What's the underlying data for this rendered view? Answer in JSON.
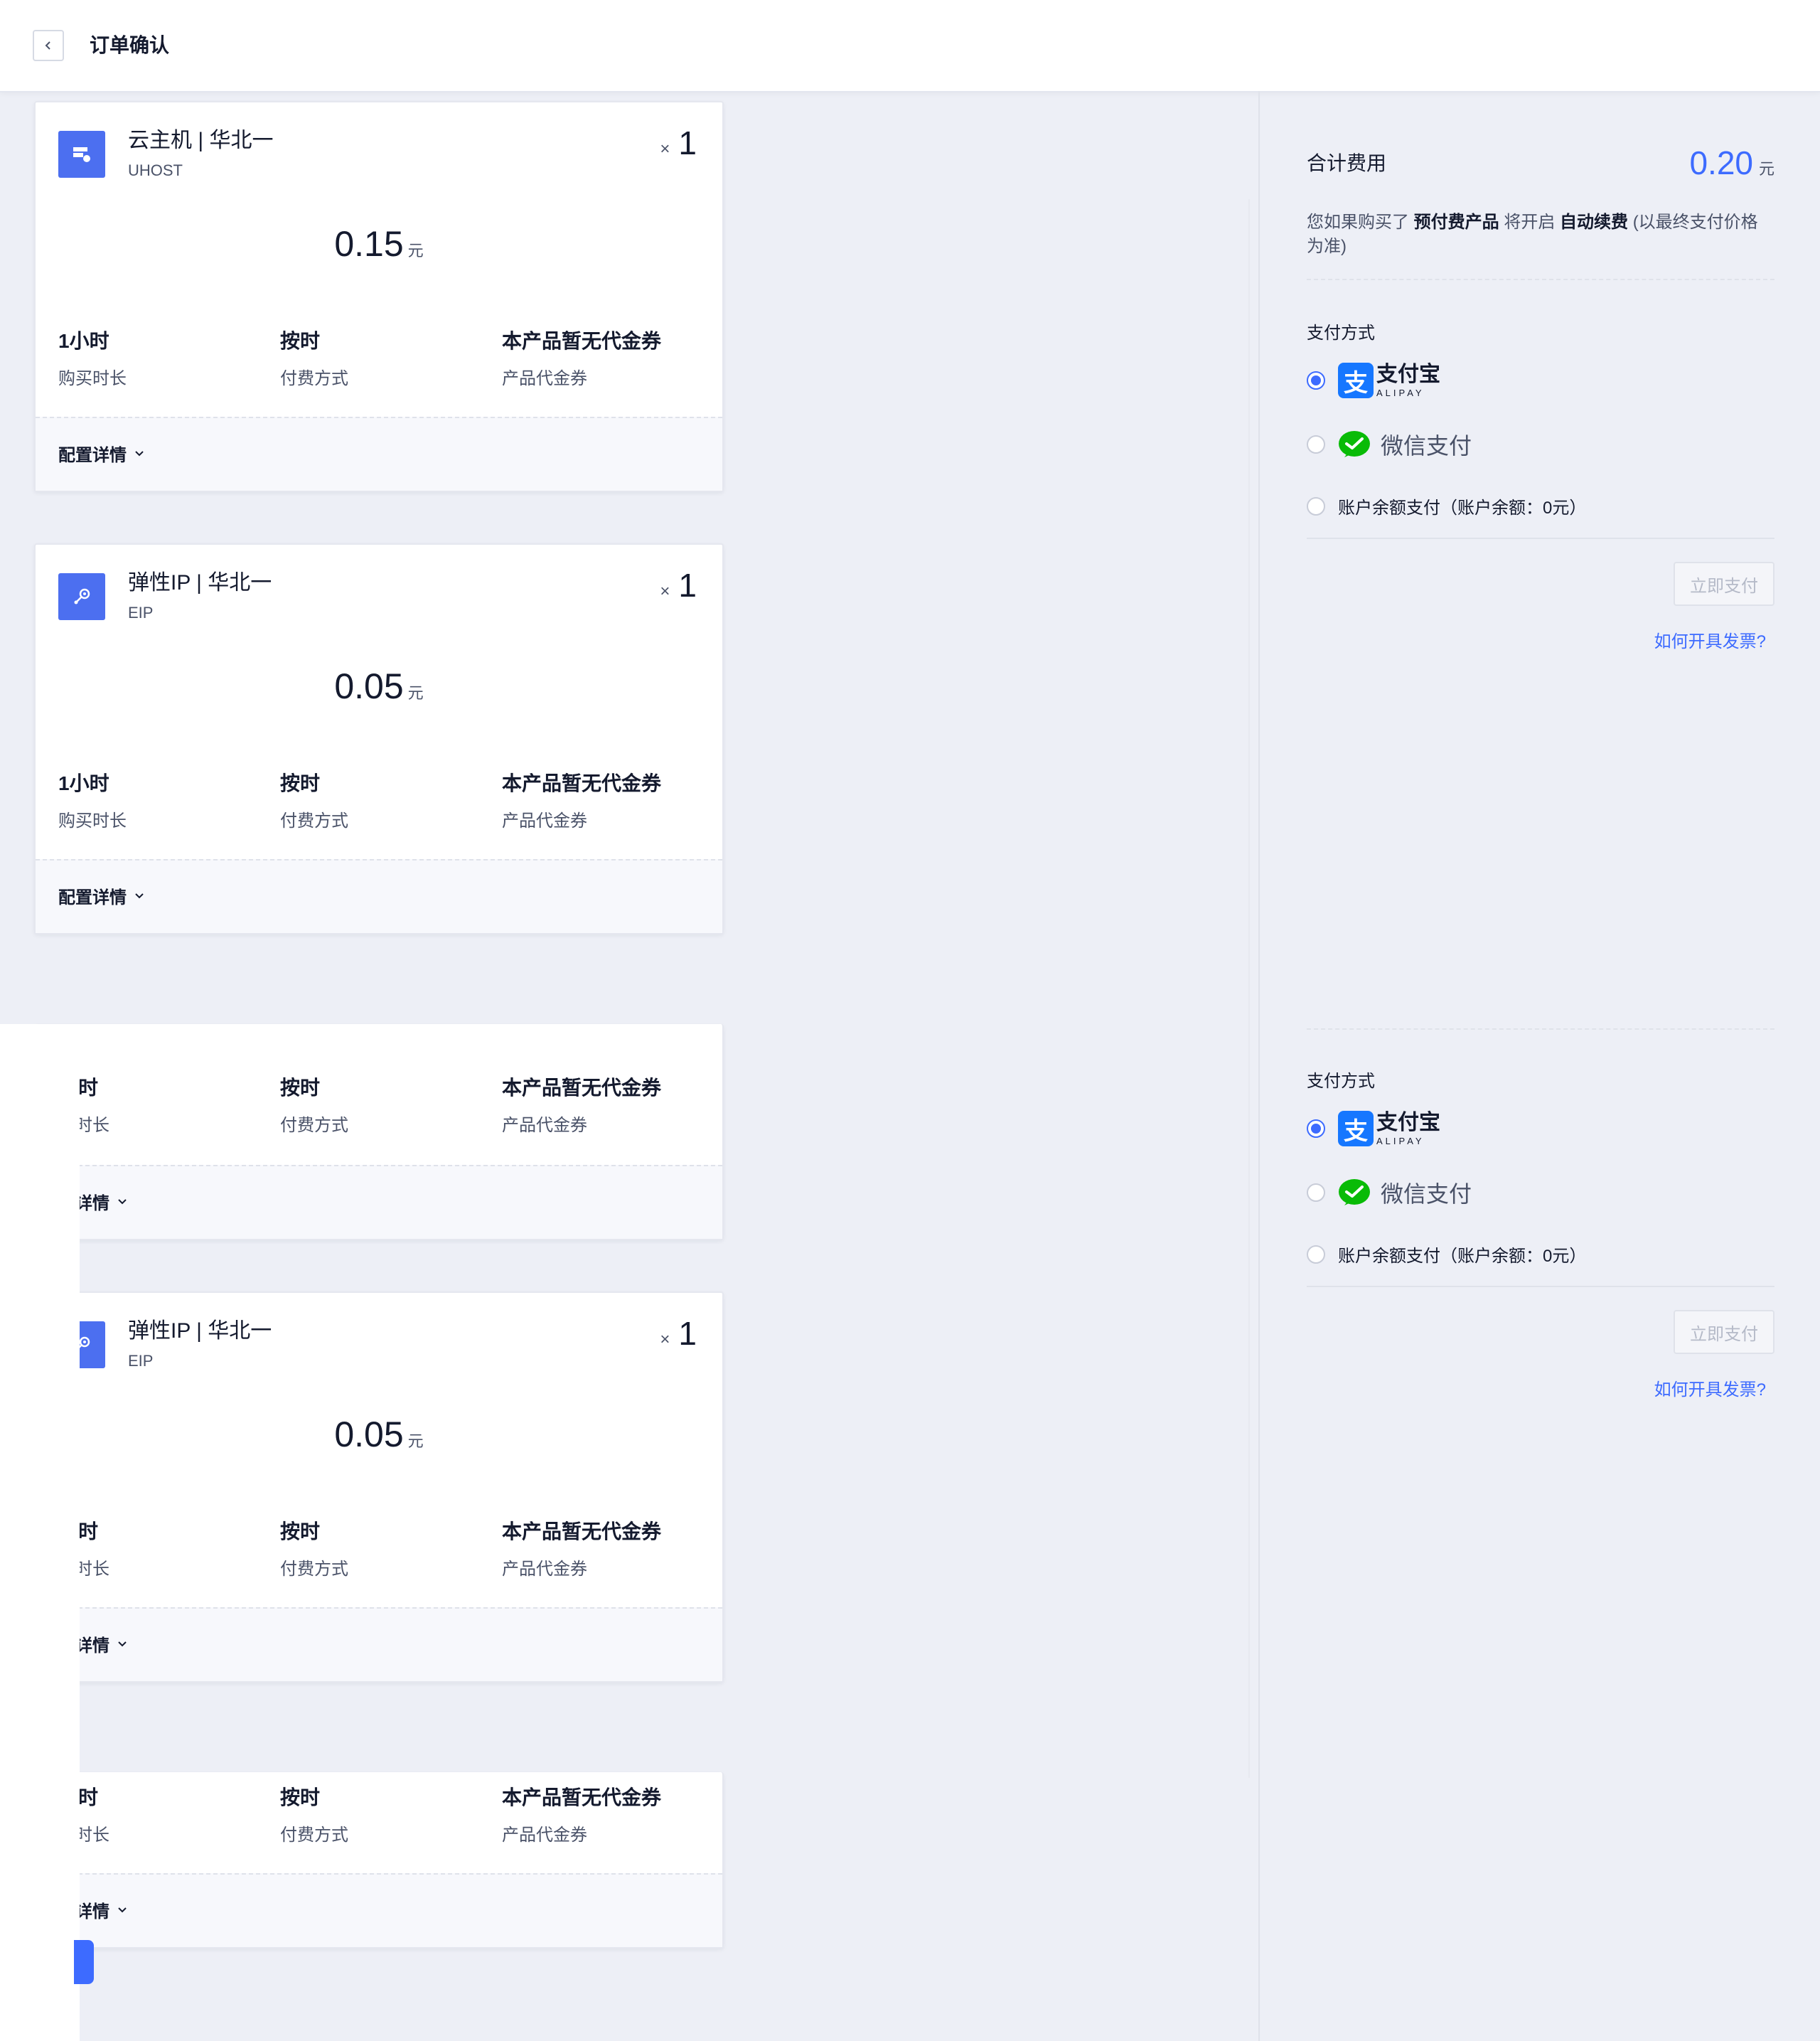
{
  "header": {
    "title": "订单确认"
  },
  "cards": [
    {
      "name": "云主机 | 华北一",
      "code": "UHOST",
      "qty_x": "×",
      "qty": "1",
      "price": "0.15",
      "unit": "元",
      "duration": "1小时",
      "duration_label": "购买时长",
      "billing": "按时",
      "billing_label": "付费方式",
      "coupon": "本产品暂无代金券",
      "coupon_label": "产品代金券",
      "config": "配置详情"
    },
    {
      "name": "弹性IP | 华北一",
      "code": "EIP",
      "qty_x": "×",
      "qty": "1",
      "price": "0.05",
      "unit": "元",
      "duration": "1小时",
      "duration_label": "购买时长",
      "billing": "按时",
      "billing_label": "付费方式",
      "coupon": "本产品暂无代金券",
      "coupon_label": "产品代金券",
      "config": "配置详情"
    },
    {
      "duration": "小时",
      "duration_label": "买时长",
      "billing": "按时",
      "billing_label": "付费方式",
      "coupon": "本产品暂无代金券",
      "coupon_label": "产品代金券",
      "config": "置详情"
    },
    {
      "name": "弹性IP | 华北一",
      "code": "EIP",
      "qty_x": "×",
      "qty": "1",
      "price": "0.05",
      "unit": "元",
      "duration": "小时",
      "duration_label": "买时长",
      "billing": "按时",
      "billing_label": "付费方式",
      "coupon": "本产品暂无代金券",
      "coupon_label": "产品代金券",
      "config": "置详情"
    },
    {
      "duration": "小时",
      "duration_label": "买时长",
      "billing": "按时",
      "billing_label": "付费方式",
      "coupon": "本产品暂无代金券",
      "coupon_label": "产品代金券",
      "config": "置详情"
    }
  ],
  "summary": {
    "total_label": "合计费用",
    "total": "0.20",
    "unit": "元",
    "notice_pre": "您如果购买了",
    "notice_b1": "预付费产品",
    "notice_mid": "将开启",
    "notice_b2": "自动续费",
    "notice_post": "(以最终支付价格为准)"
  },
  "payment_blocks": [
    {
      "title": "支付方式",
      "alipay_cn": "支付宝",
      "alipay_en": "ALIPAY",
      "alipay_glyph": "支",
      "wechat": "微信支付",
      "balance": "账户余额支付（账户余额：0元）",
      "pay_button": "立即支付",
      "invoice": "如何开具发票?",
      "selected": "alipay"
    },
    {
      "title": "支付方式",
      "alipay_cn": "支付宝",
      "alipay_en": "ALIPAY",
      "alipay_glyph": "支",
      "wechat": "微信支付",
      "balance": "账户余额支付（账户余额：0元）",
      "pay_button": "立即支付",
      "invoice": "如何开具发票?",
      "selected": "alipay"
    }
  ],
  "colors": {
    "accent": "#3d6bff",
    "alipay": "#1677ff",
    "wechat": "#09bb07",
    "icon_bg": "#4c6ff0"
  },
  "icons": {
    "back": "chevron-left-icon",
    "host": "server-icon",
    "eip": "network-icon",
    "expand": "chevron-down-icon"
  }
}
